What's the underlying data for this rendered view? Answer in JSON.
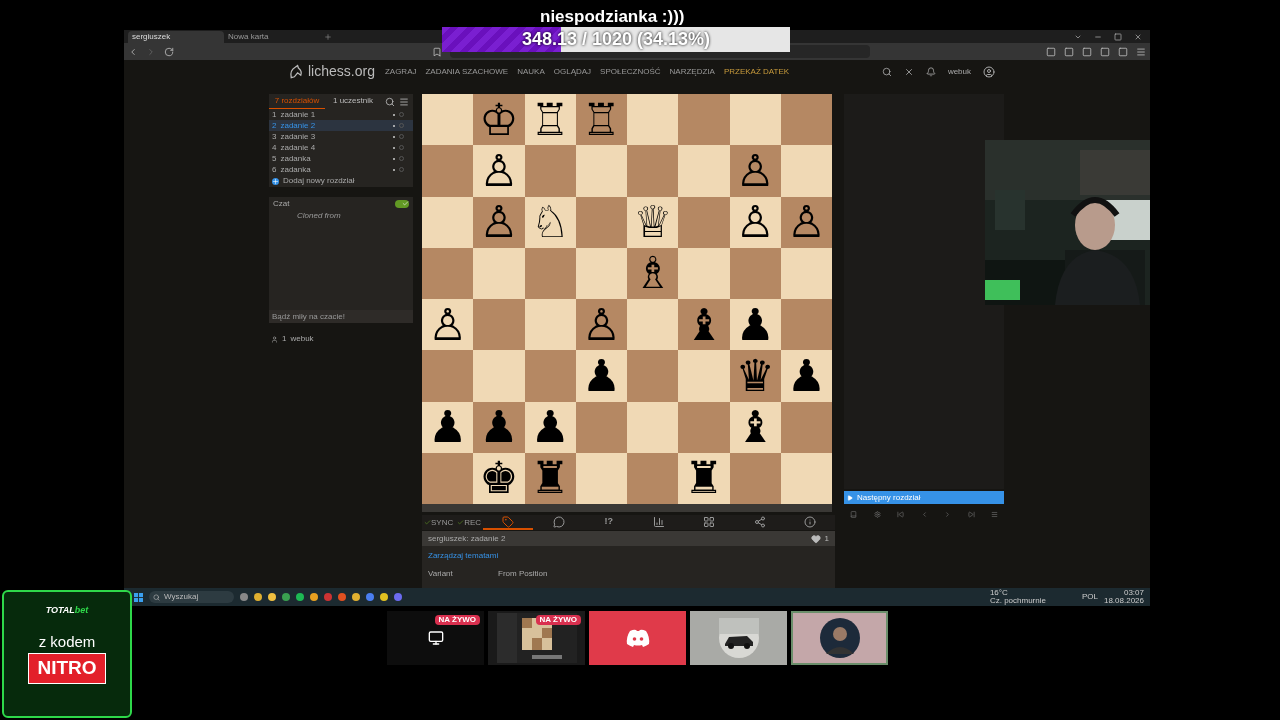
{
  "stream_overlay": {
    "title": "niespodzianka :)))",
    "goal": {
      "text": "348.13 / 1020 (34.13%)",
      "level": 0.3413
    }
  },
  "browser": {
    "tabs": [
      {
        "label": "sergiuszek",
        "selected": true
      },
      {
        "label": "Nowa karta",
        "selected": false
      }
    ]
  },
  "site": {
    "logo": "lichess.org",
    "nav": [
      {
        "label": "ZAGRAJ",
        "kind": "link"
      },
      {
        "label": "ZADANIA SZACHOWE",
        "kind": "link"
      },
      {
        "label": "NAUKA",
        "kind": "link"
      },
      {
        "label": "OGLĄDAJ",
        "kind": "link"
      },
      {
        "label": "SPOŁECZNOŚĆ",
        "kind": "link"
      },
      {
        "label": "NARZĘDZIA",
        "kind": "link"
      },
      {
        "label": "PRZEKAŻ DATEK",
        "kind": "donate"
      }
    ],
    "user": "webuk"
  },
  "study": {
    "tabs": [
      {
        "label": "7 rozdziałów",
        "selected": true
      },
      {
        "label": "1 uczestnik",
        "selected": false
      }
    ],
    "chapters": [
      {
        "number": "1",
        "name": "zadanie 1",
        "selected": false
      },
      {
        "number": "2",
        "name": "zadanie 2",
        "selected": true
      },
      {
        "number": "3",
        "name": "zadanie 3",
        "selected": false
      },
      {
        "number": "4",
        "name": "zadanie 4",
        "selected": false
      },
      {
        "number": "5",
        "name": "zadanka",
        "selected": false
      },
      {
        "number": "6",
        "name": "zadanka",
        "selected": false
      }
    ],
    "add_chapter": "Dodaj nowy rozdział",
    "chat": {
      "title": "Czat",
      "on": true,
      "message": "Cloned from",
      "placeholder": "Bądź miły na czacie!"
    },
    "members": [
      {
        "count": "1",
        "name": "webuk"
      }
    ]
  },
  "board": [
    [
      {
        "kind": "empty"
      },
      {
        "kind": "piece",
        "piece": "♔"
      },
      {
        "kind": "piece",
        "piece": "♖"
      },
      {
        "kind": "piece",
        "piece": "♖"
      },
      {
        "kind": "empty"
      },
      {
        "kind": "empty"
      },
      {
        "kind": "empty"
      },
      {
        "kind": "empty"
      }
    ],
    [
      {
        "kind": "empty"
      },
      {
        "kind": "piece",
        "piece": "♙"
      },
      {
        "kind": "empty"
      },
      {
        "kind": "empty"
      },
      {
        "kind": "empty"
      },
      {
        "kind": "empty"
      },
      {
        "kind": "piece",
        "piece": "♙"
      },
      {
        "kind": "empty"
      }
    ],
    [
      {
        "kind": "empty"
      },
      {
        "kind": "piece",
        "piece": "♙"
      },
      {
        "kind": "piece",
        "piece": "♘"
      },
      {
        "kind": "empty"
      },
      {
        "kind": "piece",
        "piece": "♕"
      },
      {
        "kind": "empty"
      },
      {
        "kind": "piece",
        "piece": "♙"
      },
      {
        "kind": "piece",
        "piece": "♙"
      }
    ],
    [
      {
        "kind": "empty"
      },
      {
        "kind": "empty"
      },
      {
        "kind": "empty"
      },
      {
        "kind": "empty"
      },
      {
        "kind": "piece",
        "piece": "♗"
      },
      {
        "kind": "empty"
      },
      {
        "kind": "empty"
      },
      {
        "kind": "empty"
      }
    ],
    [
      {
        "kind": "piece",
        "piece": "♙"
      },
      {
        "kind": "empty"
      },
      {
        "kind": "empty"
      },
      {
        "kind": "piece",
        "piece": "♙"
      },
      {
        "kind": "empty"
      },
      {
        "kind": "piece",
        "piece": "♝"
      },
      {
        "kind": "piece",
        "piece": "♟"
      },
      {
        "kind": "empty"
      }
    ],
    [
      {
        "kind": "empty"
      },
      {
        "kind": "empty"
      },
      {
        "kind": "empty"
      },
      {
        "kind": "piece",
        "piece": "♟"
      },
      {
        "kind": "empty"
      },
      {
        "kind": "empty"
      },
      {
        "kind": "piece",
        "piece": "♛"
      },
      {
        "kind": "piece",
        "piece": "♟"
      }
    ],
    [
      {
        "kind": "piece",
        "piece": "♟"
      },
      {
        "kind": "piece",
        "piece": "♟"
      },
      {
        "kind": "piece",
        "piece": "♟"
      },
      {
        "kind": "empty"
      },
      {
        "kind": "empty"
      },
      {
        "kind": "empty"
      },
      {
        "kind": "piece",
        "piece": "♝"
      },
      {
        "kind": "empty"
      }
    ],
    [
      {
        "kind": "empty"
      },
      {
        "kind": "piece",
        "piece": "♚"
      },
      {
        "kind": "piece",
        "piece": "♜"
      },
      {
        "kind": "empty"
      },
      {
        "kind": "empty"
      },
      {
        "kind": "piece",
        "piece": "♜"
      },
      {
        "kind": "empty"
      },
      {
        "kind": "empty"
      }
    ]
  ],
  "tools": {
    "sync": "SYNC",
    "rec": "REC",
    "items": [
      {
        "kind": "tags",
        "selected": true
      },
      {
        "kind": "comments",
        "selected": false
      },
      {
        "kind": "glyphs",
        "label": "!?",
        "selected": false
      },
      {
        "kind": "chart",
        "selected": false
      },
      {
        "kind": "multiboard",
        "selected": false
      },
      {
        "kind": "share",
        "selected": false
      },
      {
        "kind": "info",
        "selected": false
      }
    ]
  },
  "chapter_info": {
    "title": "sergiuszek: zadanie 2",
    "likes": "1",
    "topics_link": "Zarządzaj tematami",
    "tags": [
      {
        "name": "Variant",
        "value": "From Position"
      }
    ]
  },
  "next_chapter": "Następny rozdział",
  "taskbar": {
    "search_placeholder": "Wyszukaj",
    "weather_temp": "16°C",
    "weather_desc": "Cz. pochmurnie",
    "language": "POL",
    "time": "03:07",
    "date": "18.08.2026"
  },
  "stream_tiles": [
    {
      "kind": "screen",
      "live": "NA ŻYWO",
      "selected": false
    },
    {
      "kind": "board",
      "live": "NA ŻYWO",
      "selected": false
    },
    {
      "kind": "discord",
      "selected": false
    },
    {
      "kind": "car",
      "selected": false
    },
    {
      "kind": "avatar",
      "selected": true
    }
  ],
  "promo": {
    "brand": "TOTAL",
    "brand_suffix": "bet",
    "line": "z kodem",
    "code": "NITRO"
  }
}
